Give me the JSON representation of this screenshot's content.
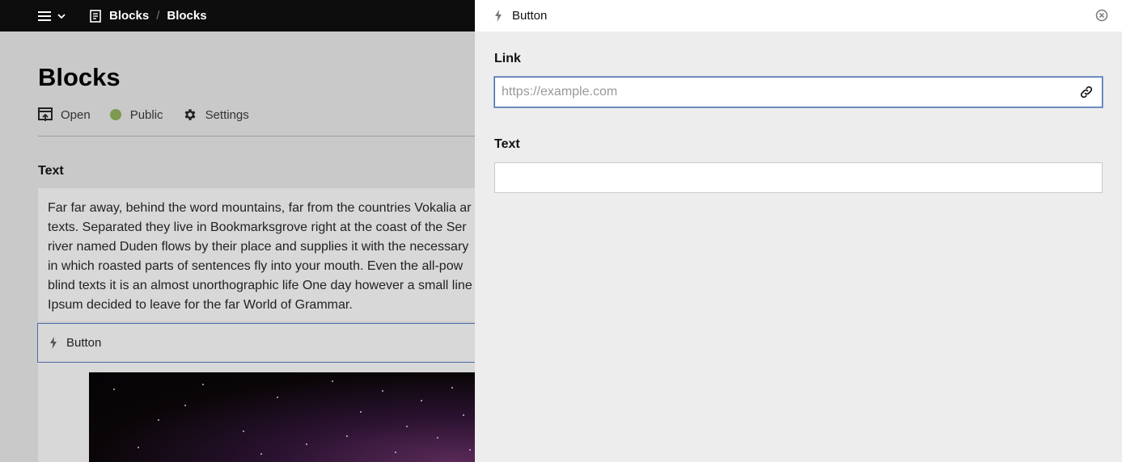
{
  "topbar": {
    "breadcrumbs": [
      "Blocks",
      "Blocks"
    ],
    "separator": "/"
  },
  "page": {
    "title": "Blocks",
    "status": {
      "open_label": "Open",
      "public_label": "Public",
      "settings_label": "Settings",
      "public_color": "#7d9a4e"
    },
    "text_section_label": "Text",
    "text_lines": [
      "Far far away, behind the word mountains, far from the countries Vokalia ar",
      "texts. Separated they live in Bookmarksgrove right at the coast of the Ser",
      "river named Duden flows by their place and supplies it with the necessary",
      "in which roasted parts of sentences fly into your mouth. Even the all-pow",
      "blind texts it is an almost unorthographic life One day however a small line",
      "Ipsum decided to leave for the far World of Grammar."
    ],
    "button_block_label": "Button"
  },
  "drawer": {
    "title": "Button",
    "link": {
      "label": "Link",
      "value": "",
      "placeholder": "https://example.com"
    },
    "text": {
      "label": "Text",
      "value": "",
      "placeholder": ""
    },
    "accent_color": "#4b6ea7"
  }
}
